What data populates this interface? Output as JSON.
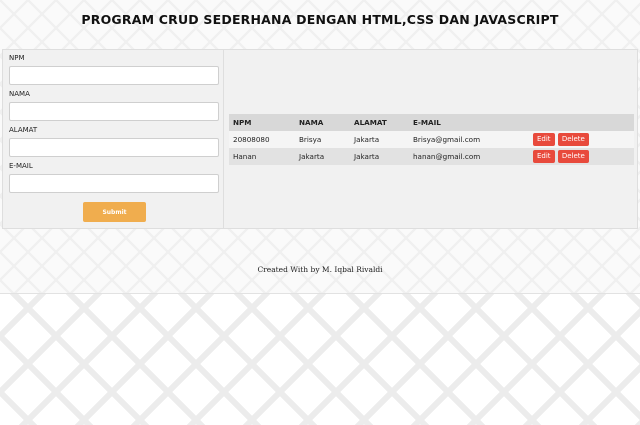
{
  "header": {
    "title": "PROGRAM CRUD SEDERHANA DENGAN HTML,CSS DAN JAVASCRIPT"
  },
  "form": {
    "fields": [
      {
        "label": "NPM",
        "value": "",
        "placeholder": ""
      },
      {
        "label": "NAMA",
        "value": "",
        "placeholder": ""
      },
      {
        "label": "ALAMAT",
        "value": "",
        "placeholder": ""
      },
      {
        "label": "E-MAIL",
        "value": "",
        "placeholder": ""
      }
    ],
    "submit_label": "Submit"
  },
  "table": {
    "headers": [
      "NPM",
      "NAMA",
      "ALAMAT",
      "E-MAIL",
      ""
    ],
    "rows": [
      {
        "npm": "20808080",
        "nama": "Brisya",
        "alamat": "Jakarta",
        "email": "Brisya@gmail.com",
        "edit_label": "Edit",
        "delete_label": "Delete"
      },
      {
        "npm": "Hanan",
        "nama": "Jakarta",
        "alamat": "Jakarta",
        "email": "hanan@gmail.com",
        "edit_label": "Edit",
        "delete_label": "Delete"
      }
    ]
  },
  "footer": {
    "text": "Created With by M. Iqbal Rivaldi"
  },
  "colors": {
    "submit": "#f0ad4e",
    "action_button": "#e84a3c",
    "panel": "#f1f1f1"
  }
}
